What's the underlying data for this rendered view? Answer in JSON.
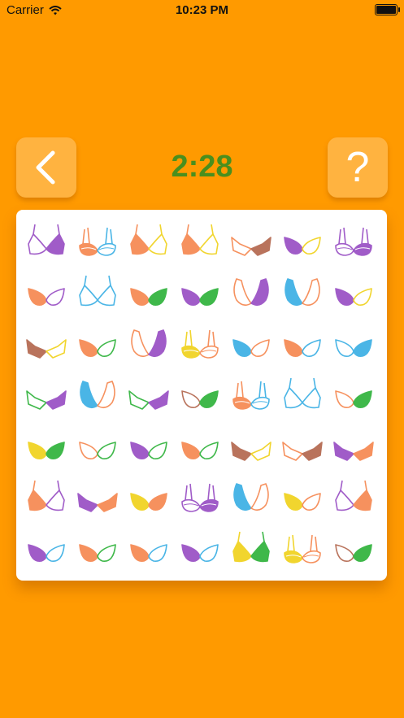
{
  "status_bar": {
    "carrier": "Carrier",
    "time": "10:23 PM"
  },
  "header": {
    "timer": "2:28",
    "back_icon": "chevron-left-icon",
    "help_label": "?"
  },
  "colors": {
    "background": "#FF9A00",
    "button": "#FFB340",
    "timer": "#4A8F1E",
    "palette": {
      "purple": "#A05CC8",
      "orange": "#F6915E",
      "blue": "#4AB5E6",
      "green": "#3FB84A",
      "yellow": "#F1D52E",
      "brown": "#B9735C"
    }
  },
  "board": {
    "rows": [
      [
        {
          "style": "pushup",
          "left": "purple",
          "right": "purple",
          "fill": "right"
        },
        {
          "style": "balcon",
          "left": "orange",
          "right": "blue",
          "fill": "left"
        },
        {
          "style": "pushup",
          "left": "orange",
          "right": "yellow",
          "fill": "left"
        },
        {
          "style": "pushup",
          "left": "orange",
          "right": "yellow",
          "fill": "left"
        },
        {
          "style": "plunge",
          "left": "orange",
          "right": "brown",
          "fill": "right"
        },
        {
          "style": "round",
          "left": "purple",
          "right": "yellow",
          "fill": "left"
        },
        {
          "style": "balcon",
          "left": "purple",
          "right": "purple",
          "fill": "right"
        }
      ],
      [
        {
          "style": "round",
          "left": "orange",
          "right": "purple",
          "fill": "left"
        },
        {
          "style": "pushup",
          "left": "blue",
          "right": "blue",
          "fill": "none"
        },
        {
          "style": "round",
          "left": "orange",
          "right": "green",
          "fill": "both"
        },
        {
          "style": "round",
          "left": "purple",
          "right": "green",
          "fill": "both"
        },
        {
          "style": "triangle",
          "left": "orange",
          "right": "purple",
          "fill": "right"
        },
        {
          "style": "triangle",
          "left": "blue",
          "right": "orange",
          "fill": "left"
        },
        {
          "style": "round",
          "left": "purple",
          "right": "yellow",
          "fill": "left"
        }
      ],
      [
        {
          "style": "plunge",
          "left": "brown",
          "right": "yellow",
          "fill": "left"
        },
        {
          "style": "round",
          "left": "orange",
          "right": "green",
          "fill": "left"
        },
        {
          "style": "triangle",
          "left": "orange",
          "right": "purple",
          "fill": "right"
        },
        {
          "style": "balcon",
          "left": "yellow",
          "right": "orange",
          "fill": "left"
        },
        {
          "style": "round",
          "left": "blue",
          "right": "orange",
          "fill": "left"
        },
        {
          "style": "round",
          "left": "orange",
          "right": "blue",
          "fill": "left"
        },
        {
          "style": "round",
          "left": "blue",
          "right": "blue",
          "fill": "right"
        }
      ],
      [
        {
          "style": "plunge",
          "left": "green",
          "right": "purple",
          "fill": "right"
        },
        {
          "style": "triangle",
          "left": "blue",
          "right": "orange",
          "fill": "left"
        },
        {
          "style": "plunge",
          "left": "green",
          "right": "purple",
          "fill": "right"
        },
        {
          "style": "round",
          "left": "brown",
          "right": "green",
          "fill": "right"
        },
        {
          "style": "balcon",
          "left": "orange",
          "right": "blue",
          "fill": "left"
        },
        {
          "style": "pushup",
          "left": "blue",
          "right": "blue",
          "fill": "none"
        },
        {
          "style": "round",
          "left": "orange",
          "right": "green",
          "fill": "right"
        }
      ],
      [
        {
          "style": "round",
          "left": "yellow",
          "right": "green",
          "fill": "both"
        },
        {
          "style": "round",
          "left": "orange",
          "right": "green",
          "fill": "none"
        },
        {
          "style": "round",
          "left": "purple",
          "right": "green",
          "fill": "left"
        },
        {
          "style": "round",
          "left": "orange",
          "right": "green",
          "fill": "left"
        },
        {
          "style": "plunge",
          "left": "brown",
          "right": "yellow",
          "fill": "left"
        },
        {
          "style": "plunge",
          "left": "orange",
          "right": "brown",
          "fill": "right"
        },
        {
          "style": "plunge",
          "left": "purple",
          "right": "orange",
          "fill": "both"
        }
      ],
      [
        {
          "style": "pushup",
          "left": "orange",
          "right": "purple",
          "fill": "left"
        },
        {
          "style": "plunge",
          "left": "purple",
          "right": "orange",
          "fill": "both"
        },
        {
          "style": "round",
          "left": "yellow",
          "right": "orange",
          "fill": "both"
        },
        {
          "style": "balcon",
          "left": "purple",
          "right": "purple",
          "fill": "right"
        },
        {
          "style": "triangle",
          "left": "blue",
          "right": "orange",
          "fill": "left"
        },
        {
          "style": "round",
          "left": "yellow",
          "right": "orange",
          "fill": "left"
        },
        {
          "style": "pushup",
          "left": "purple",
          "right": "orange",
          "fill": "right"
        }
      ],
      [
        {
          "style": "round",
          "left": "purple",
          "right": "blue",
          "fill": "left"
        },
        {
          "style": "round",
          "left": "orange",
          "right": "green",
          "fill": "left"
        },
        {
          "style": "round",
          "left": "orange",
          "right": "blue",
          "fill": "left"
        },
        {
          "style": "round",
          "left": "purple",
          "right": "blue",
          "fill": "left"
        },
        {
          "style": "pushup",
          "left": "yellow",
          "right": "green",
          "fill": "both"
        },
        {
          "style": "balcon",
          "left": "yellow",
          "right": "orange",
          "fill": "left"
        },
        {
          "style": "round",
          "left": "brown",
          "right": "green",
          "fill": "right"
        }
      ]
    ]
  }
}
